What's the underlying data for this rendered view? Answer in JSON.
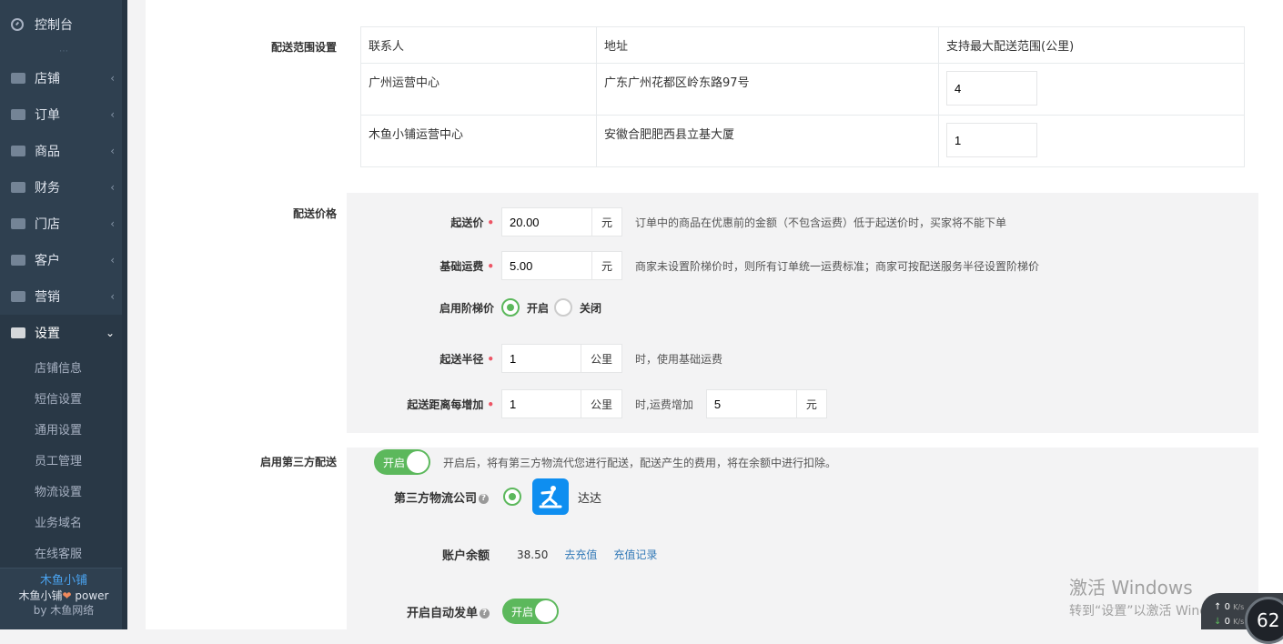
{
  "sidebar": {
    "top": "控制台",
    "items": [
      {
        "label": "店铺",
        "icon": "store-icon"
      },
      {
        "label": "订单",
        "icon": "order-icon"
      },
      {
        "label": "商品",
        "icon": "scale-icon"
      },
      {
        "label": "财务",
        "icon": "money-icon"
      },
      {
        "label": "门店",
        "icon": "sitemap-icon"
      },
      {
        "label": "客户",
        "icon": "users-icon"
      },
      {
        "label": "营销",
        "icon": "gift-icon"
      }
    ],
    "active": {
      "label": "设置",
      "icon": "wrench-icon"
    },
    "submenu": [
      "店铺信息",
      "短信设置",
      "通用设置",
      "员工管理",
      "物流设置",
      "业务域名",
      "在线客服"
    ],
    "footer": {
      "brand": "木鱼小铺",
      "power_pre": "木鱼小铺",
      "power_post": " power",
      "by": "by 木鱼网络"
    }
  },
  "range": {
    "label": "配送范围设置",
    "headers": [
      "联系人",
      "地址",
      "支持最大配送范围(公里)"
    ],
    "rows": [
      {
        "contact": "广州运营中心",
        "address": "广东广州花都区岭东路97号",
        "range": "4"
      },
      {
        "contact": "木鱼小铺运营中心",
        "address": "安徽合肥肥西县立基大厦",
        "range": "1"
      }
    ]
  },
  "price": {
    "label": "配送价格",
    "start_price": {
      "label": "起送价",
      "value": "20.00",
      "unit": "元",
      "hint": "订单中的商品在优惠前的金额（不包含运费）低于起送价时，买家将不能下单"
    },
    "base_fee": {
      "label": "基础运费",
      "value": "5.00",
      "unit": "元",
      "hint": "商家未设置阶梯价时，则所有订单统一运费标准；商家可按配送服务半径设置阶梯价"
    },
    "tier": {
      "label": "启用阶梯价",
      "on": "开启",
      "off": "关闭"
    },
    "radius": {
      "label": "起送半径",
      "value": "1",
      "unit": "公里",
      "hint": "时，使用基础运费"
    },
    "increase": {
      "label": "起送距离每增加",
      "value": "1",
      "unit": "公里",
      "mid": "时,运费增加",
      "fee": "5",
      "fee_unit": "元"
    }
  },
  "third": {
    "label": "启用第三方配送",
    "toggle": "开启",
    "hint": "开启后，将有第三方物流代您进行配送，配送产生的费用，将在余额中进行扣除。",
    "company_label": "第三方物流公司",
    "company": "达达",
    "balance_label": "账户余额",
    "balance": "38.50",
    "recharge": "去充值",
    "history": "充值记录",
    "auto_label": "开启自动发单",
    "auto_toggle": "开启"
  },
  "watermark": {
    "line1": "激活 Windows",
    "line2": "转到“设置”以激活 Windows。"
  },
  "netwidget": {
    "up": "0",
    "up_unit": "K/s",
    "down": "0",
    "down_unit": "K/s",
    "cpu": "62"
  }
}
